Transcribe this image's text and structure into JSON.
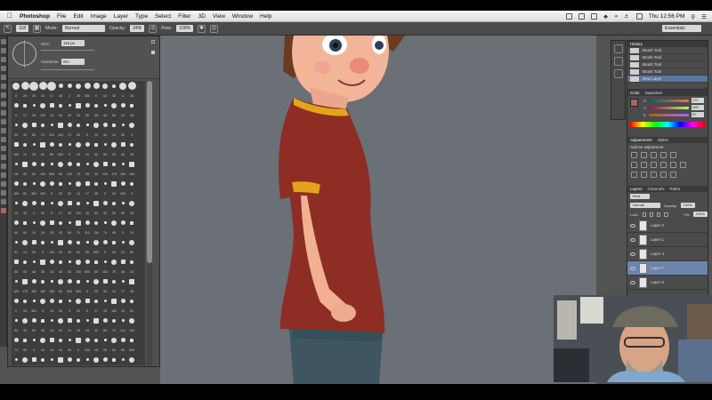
{
  "menubar": {
    "app_name": "Photoshop",
    "items": [
      "File",
      "Edit",
      "Image",
      "Layer",
      "Type",
      "Select",
      "Filter",
      "3D",
      "View",
      "Window",
      "Help"
    ],
    "clock": "Thu 12:56 PM"
  },
  "options_bar": {
    "brush_size": "118",
    "mode_label": "Mode:",
    "mode_value": "Normal",
    "opacity_label": "Opacity:",
    "opacity_value": "24%",
    "flow_label": "Flow:",
    "flow_value": "100%",
    "workspace": "Essentials"
  },
  "brush_panel": {
    "size_label": "Size:",
    "size_value": "118 px",
    "hardness_label": "Hardness:",
    "hardness_value": "0%",
    "brush_numbers": [
      "5",
      "25",
      "30",
      "10",
      "17",
      "38",
      "2",
      "26",
      "300",
      "9",
      "10",
      "30",
      "4",
      "30",
      "6",
      "17",
      "28",
      "100",
      "15",
      "50",
      "30",
      "30",
      "59",
      "36",
      "44",
      "60",
      "14",
      "26",
      "33",
      "42",
      "55",
      "70",
      "112",
      "134",
      "74",
      "95",
      "5",
      "19",
      "44",
      "10",
      "30",
      "9",
      "100",
      "19",
      "28",
      "60",
      "89",
      "500",
      "9",
      "49",
      "10",
      "50",
      "55",
      "93",
      "46",
      "35",
      "16",
      "40",
      "50",
      "100",
      "500",
      "55",
      "100",
      "75",
      "45",
      "20",
      "125",
      "175",
      "150",
      "160",
      "165",
      "80",
      "300",
      "260"
    ]
  },
  "history": {
    "title": "History",
    "items": [
      "Brush Tool",
      "Brush Tool",
      "Brush Tool",
      "Brush Tool",
      "New Layer"
    ]
  },
  "color": {
    "tabs": [
      "Color",
      "Swatches"
    ],
    "r": "171",
    "g": "100",
    "b": "97",
    "foreground": "#ab6461",
    "background": "#ffffff"
  },
  "adjustments": {
    "tabs": [
      "Adjustments",
      "Styles"
    ],
    "heading": "Add an adjustment"
  },
  "layers": {
    "tabs": [
      "Layers",
      "Channels",
      "Paths"
    ],
    "filter": "Kind",
    "blend_mode": "Normal",
    "opacity_label": "Opacity:",
    "opacity": "100%",
    "lock_label": "Lock:",
    "fill_label": "Fill:",
    "fill": "100%",
    "items": [
      "Layer 2",
      "Layer 1",
      "Layer 4",
      "Layer 7",
      "Layer 6"
    ],
    "selected": "Layer 7"
  }
}
